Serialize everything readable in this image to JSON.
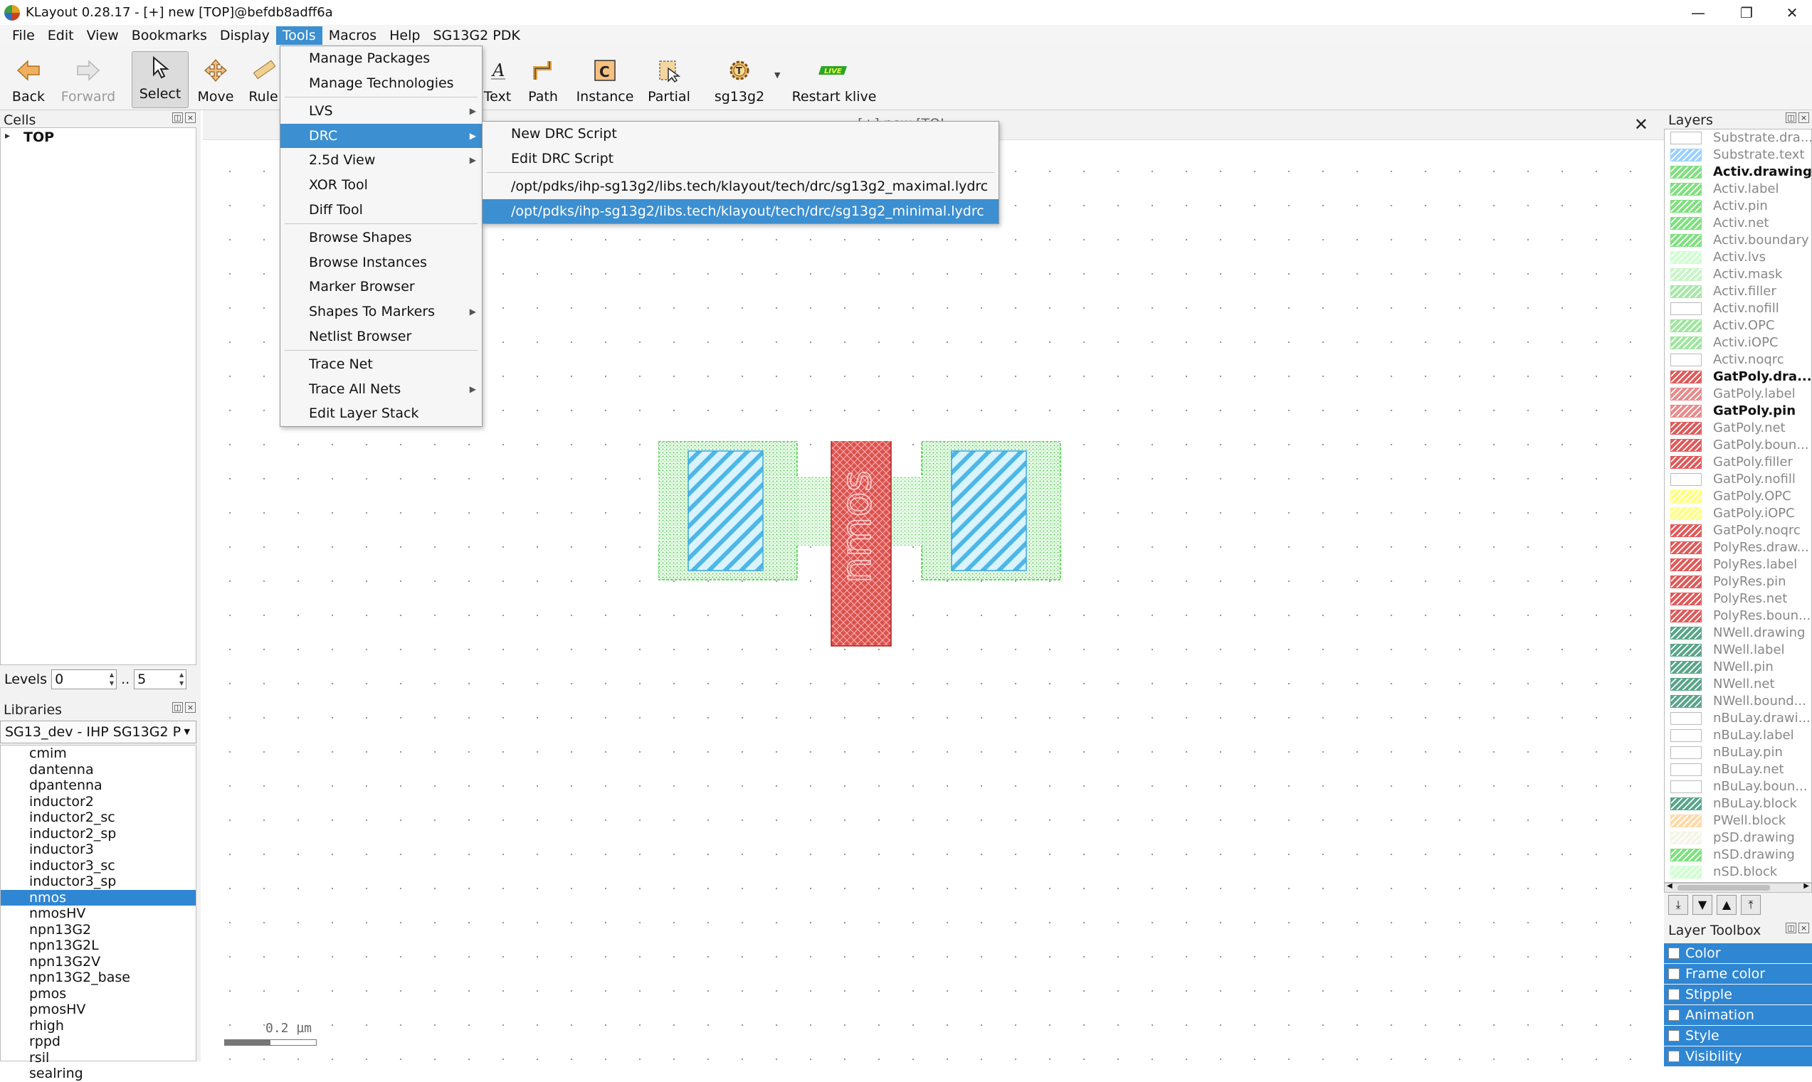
{
  "window": {
    "title": "KLayout 0.28.17 - [+] new [TOP]@befdb8adff6a",
    "minimize": "—",
    "maximize": "❐",
    "close": "✕"
  },
  "menubar": [
    "File",
    "Edit",
    "View",
    "Bookmarks",
    "Display",
    "Tools",
    "Macros",
    "Help",
    "SG13G2 PDK"
  ],
  "menubar_active": "Tools",
  "toolbar": {
    "back": "Back",
    "forward": "Forward",
    "select": "Select",
    "move": "Move",
    "ruler": "Rule",
    "text": "Text",
    "path": "Path",
    "instance": "Instance",
    "partial": "Partial",
    "sg13g2": "sg13g2",
    "restart": "Restart klive",
    "live_badge": "LIVE"
  },
  "tools_menu": [
    {
      "label": "Manage Packages"
    },
    {
      "label": "Manage Technologies"
    },
    {
      "sep": true
    },
    {
      "label": "LVS",
      "sub": true
    },
    {
      "label": "DRC",
      "sub": true,
      "highlight": true
    },
    {
      "label": "2.5d View",
      "sub": true
    },
    {
      "label": "XOR Tool"
    },
    {
      "label": "Diff Tool"
    },
    {
      "sep": true
    },
    {
      "label": "Browse Shapes"
    },
    {
      "label": "Browse Instances"
    },
    {
      "label": "Marker Browser"
    },
    {
      "label": "Shapes To Markers",
      "sub": true
    },
    {
      "label": "Netlist Browser"
    },
    {
      "sep": true
    },
    {
      "label": "Trace Net"
    },
    {
      "label": "Trace All Nets",
      "sub": true
    },
    {
      "label": "Edit Layer Stack"
    }
  ],
  "drc_submenu": [
    {
      "label": "New DRC Script"
    },
    {
      "label": "Edit DRC Script"
    },
    {
      "sep": true
    },
    {
      "label": "/opt/pdks/ihp-sg13g2/libs.tech/klayout/tech/drc/sg13g2_maximal.lydrc"
    },
    {
      "label": "/opt/pdks/ihp-sg13g2/libs.tech/klayout/tech/drc/sg13g2_minimal.lydrc",
      "highlight": true
    }
  ],
  "cells": {
    "title": "Cells",
    "top": "TOP",
    "expander": "▸"
  },
  "levels": {
    "label": "Levels",
    "from": "0",
    "sep": "..",
    "to": "5"
  },
  "libraries": {
    "title": "Libraries",
    "selected": "SG13_dev - IHP SG13G2 P",
    "items": [
      "cmim",
      "dantenna",
      "dpantenna",
      "inductor2",
      "inductor2_sc",
      "inductor2_sp",
      "inductor3",
      "inductor3_sc",
      "inductor3_sp",
      "nmos",
      "nmosHV",
      "npn13G2",
      "npn13G2L",
      "npn13G2V",
      "npn13G2_base",
      "pmos",
      "pmosHV",
      "rhigh",
      "rppd",
      "rsil",
      "sealring"
    ],
    "selected_item": "nmos"
  },
  "canvas": {
    "scale_label": "0.2 µm",
    "close": "✕",
    "tab_hint": "[+] new [TOP]",
    "cell_label": "nmos"
  },
  "layers": {
    "title": "Layers",
    "items": [
      {
        "name": "Substrate.dra...",
        "color": "#ffffff",
        "bold": false
      },
      {
        "name": "Substrate.text",
        "color": "#9ad0ff",
        "bold": false
      },
      {
        "name": "Activ.drawing",
        "color": "#7ee07e",
        "bold": true
      },
      {
        "name": "Activ.label",
        "color": "#7ee07e",
        "bold": false
      },
      {
        "name": "Activ.pin",
        "color": "#7ee07e",
        "bold": false
      },
      {
        "name": "Activ.net",
        "color": "#7ee07e",
        "bold": false
      },
      {
        "name": "Activ.boundary",
        "color": "#7ee07e",
        "bold": false
      },
      {
        "name": "Activ.lvs",
        "color": "#cfffcf",
        "bold": false
      },
      {
        "name": "Activ.mask",
        "color": "#c8f5c8",
        "bold": false
      },
      {
        "name": "Activ.filler",
        "color": "#a7e7a7",
        "bold": false
      },
      {
        "name": "Activ.nofill",
        "color": "#ffffff",
        "bold": false
      },
      {
        "name": "Activ.OPC",
        "color": "#9fe59f",
        "bold": false
      },
      {
        "name": "Activ.iOPC",
        "color": "#9fe59f",
        "bold": false
      },
      {
        "name": "Activ.noqrc",
        "color": "#ffffff",
        "bold": false
      },
      {
        "name": "GatPoly.dra...",
        "color": "#e05a5a",
        "bold": true
      },
      {
        "name": "GatPoly.label",
        "color": "#e88b8b",
        "bold": false
      },
      {
        "name": "GatPoly.pin",
        "color": "#e88b8b",
        "bold": true
      },
      {
        "name": "GatPoly.net",
        "color": "#e05a5a",
        "bold": false
      },
      {
        "name": "GatPoly.boun...",
        "color": "#e05a5a",
        "bold": false
      },
      {
        "name": "GatPoly.filler",
        "color": "#e05a5a",
        "bold": false
      },
      {
        "name": "GatPoly.nofill",
        "color": "#ffffff",
        "bold": false
      },
      {
        "name": "GatPoly.OPC",
        "color": "#ffff80",
        "bold": false
      },
      {
        "name": "GatPoly.iOPC",
        "color": "#ffff80",
        "bold": false
      },
      {
        "name": "GatPoly.noqrc",
        "color": "#e05a5a",
        "bold": false
      },
      {
        "name": "PolyRes.draw...",
        "color": "#e05a5a",
        "bold": false
      },
      {
        "name": "PolyRes.label",
        "color": "#e05a5a",
        "bold": false
      },
      {
        "name": "PolyRes.pin",
        "color": "#e05a5a",
        "bold": false
      },
      {
        "name": "PolyRes.net",
        "color": "#e05a5a",
        "bold": false
      },
      {
        "name": "PolyRes.boun...",
        "color": "#e05a5a",
        "bold": false
      },
      {
        "name": "NWell.drawing",
        "color": "#5aa58a",
        "bold": false
      },
      {
        "name": "NWell.label",
        "color": "#5aa58a",
        "bold": false
      },
      {
        "name": "NWell.pin",
        "color": "#5aa58a",
        "bold": false
      },
      {
        "name": "NWell.net",
        "color": "#5aa58a",
        "bold": false
      },
      {
        "name": "NWell.bound...",
        "color": "#5aa58a",
        "bold": false
      },
      {
        "name": "nBuLay.drawi...",
        "color": "#ffffff",
        "bold": false
      },
      {
        "name": "nBuLay.label",
        "color": "#ffffff",
        "bold": false
      },
      {
        "name": "nBuLay.pin",
        "color": "#ffffff",
        "bold": false
      },
      {
        "name": "nBuLay.net",
        "color": "#ffffff",
        "bold": false
      },
      {
        "name": "nBuLay.boun...",
        "color": "#ffffff",
        "bold": false
      },
      {
        "name": "nBuLay.block",
        "color": "#5aa58a",
        "bold": false
      },
      {
        "name": "PWell.block",
        "color": "#ffd9a8",
        "bold": false
      },
      {
        "name": "pSD.drawing",
        "color": "#f4f4e8",
        "bold": false
      },
      {
        "name": "nSD.drawing",
        "color": "#7ee07e",
        "bold": false
      },
      {
        "name": "nSD.block",
        "color": "#cfffcf",
        "bold": false
      }
    ]
  },
  "layer_toolbox": {
    "title": "Layer Toolbox",
    "items": [
      "Color",
      "Frame color",
      "Stipple",
      "Animation",
      "Style",
      "Visibility"
    ]
  }
}
